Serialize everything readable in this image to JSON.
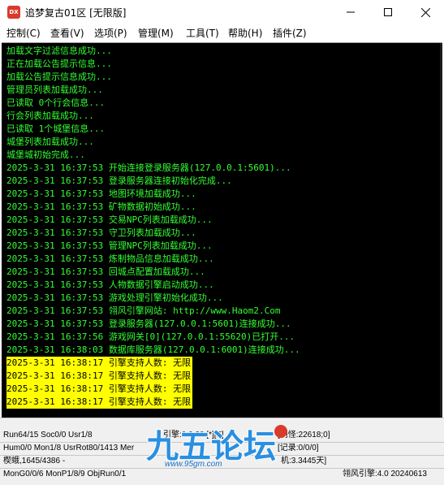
{
  "window": {
    "title": "追梦复古01区 [无限版]",
    "icon_label": "DX",
    "controls": {
      "minimize_icon": "minimize-icon",
      "maximize_icon": "maximize-icon",
      "close_icon": "close-icon"
    }
  },
  "menu": {
    "items": [
      {
        "label": "控制(C)"
      },
      {
        "label": "查看(V)"
      },
      {
        "label": "选项(P)"
      },
      {
        "label": "管理(M)"
      },
      {
        "label": "工具(T)"
      },
      {
        "label": "帮助(H)"
      },
      {
        "label": "插件(Z)"
      }
    ]
  },
  "console": {
    "text_color": "#33ff33",
    "highlight_color": "#ffff00",
    "lines": [
      {
        "text": "加载文字过滤信息成功..."
      },
      {
        "text": "正在加载公告提示信息..."
      },
      {
        "text": "加载公告提示信息成功..."
      },
      {
        "text": "管理员列表加载成功..."
      },
      {
        "text": "已读取 0个行会信息..."
      },
      {
        "text": "行会列表加载成功..."
      },
      {
        "text": "已读取 1个城堡信息..."
      },
      {
        "text": "城堡列表加载成功..."
      },
      {
        "text": "城堡城初始完成..."
      },
      {
        "text": "2025-3-31 16:37:53 开始连接登录服务器(127.0.0.1:5601)..."
      },
      {
        "text": "2025-3-31 16:37:53 登录服务器连接初始化完成..."
      },
      {
        "text": "2025-3-31 16:37:53 地图环境加载成功..."
      },
      {
        "text": "2025-3-31 16:37:53 矿物数据初始成功..."
      },
      {
        "text": "2025-3-31 16:37:53 交易NPC列表加载成功..."
      },
      {
        "text": "2025-3-31 16:37:53 守卫列表加载成功..."
      },
      {
        "text": "2025-3-31 16:37:53 管理NPC列表加载成功..."
      },
      {
        "text": "2025-3-31 16:37:53 炼制物品信息加载成功..."
      },
      {
        "text": "2025-3-31 16:37:53 回城点配置加载成功..."
      },
      {
        "text": "2025-3-31 16:37:53 人物数据引擎启动成功..."
      },
      {
        "text": "2025-3-31 16:37:53 游戏处理引擎初始化成功..."
      },
      {
        "text": "2025-3-31 16:37:53 翎风引擎网站: http://www.Haom2.Com"
      },
      {
        "text": "2025-3-31 16:37:53 登录服务器(127.0.0.1:5601)连接成功..."
      },
      {
        "text": "2025-3-31 16:37:56 游戏网关[0](127.0.0.1:55620)已打开..."
      },
      {
        "text": "2025-3-31 16:38:03 数据库服务器(127.0.0.1:6001)连接成功..."
      },
      {
        "text": "2025-3-31 16:38:17 引擎支持人数: 无限",
        "highlight": true
      },
      {
        "text": "2025-3-31 16:38:17 引擎支持人数: 无限",
        "highlight": true
      },
      {
        "text": "2025-3-31 16:38:17 引擎支持人数: 无限",
        "highlight": true
      },
      {
        "text": "2025-3-31 16:38:17 引擎支持人数: 无限",
        "highlight": true
      }
    ]
  },
  "status": {
    "row1_left": "Run64/15 Soc0/0 Usr1/8",
    "row1_mid": "引擎:0:0:30 [*][F]",
    "row1_right": "[刷怪:22618;0]",
    "row2_left": "Hum0/0 Mon1/8 UsrRot80/1413 Mer",
    "row2_right": "[记录:0/0/0]",
    "row3_left": "楔蛾,1645/4386 -",
    "row3_right": "机:3.3445天]",
    "row4_left": "MonG0/0/6 MonP1/8/9 ObjRun0/1",
    "row4_right": "翎风引擎:4.0 20240613"
  },
  "watermark": {
    "logo_text": "九五论坛",
    "url": "www.95gm.com"
  }
}
